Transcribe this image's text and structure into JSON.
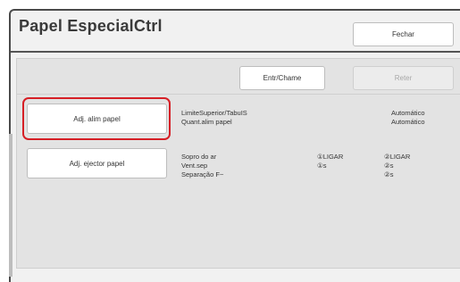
{
  "window": {
    "title": "Papel EspecialCtrl"
  },
  "header": {
    "close_label": "Fechar"
  },
  "toolbar": {
    "entry_label": "Entr/Chame",
    "save_label": "Reter"
  },
  "rows": [
    {
      "button_label": "Adj. alim papel",
      "lines": [
        "LimiteSuperior/TabuIS",
        "Quant.alim papel"
      ],
      "values_col1": [
        "",
        ""
      ],
      "values_col2": [
        "Automático",
        "Automático"
      ]
    },
    {
      "button_label": "Adj. ejector papel",
      "lines": [
        "Sopro do ar",
        "Vent.sep",
        "Separação F~"
      ],
      "values_col1": [
        "①LIGAR",
        "①s",
        ""
      ],
      "values_col2": [
        "②LIGAR",
        "②s",
        "②s"
      ]
    }
  ]
}
